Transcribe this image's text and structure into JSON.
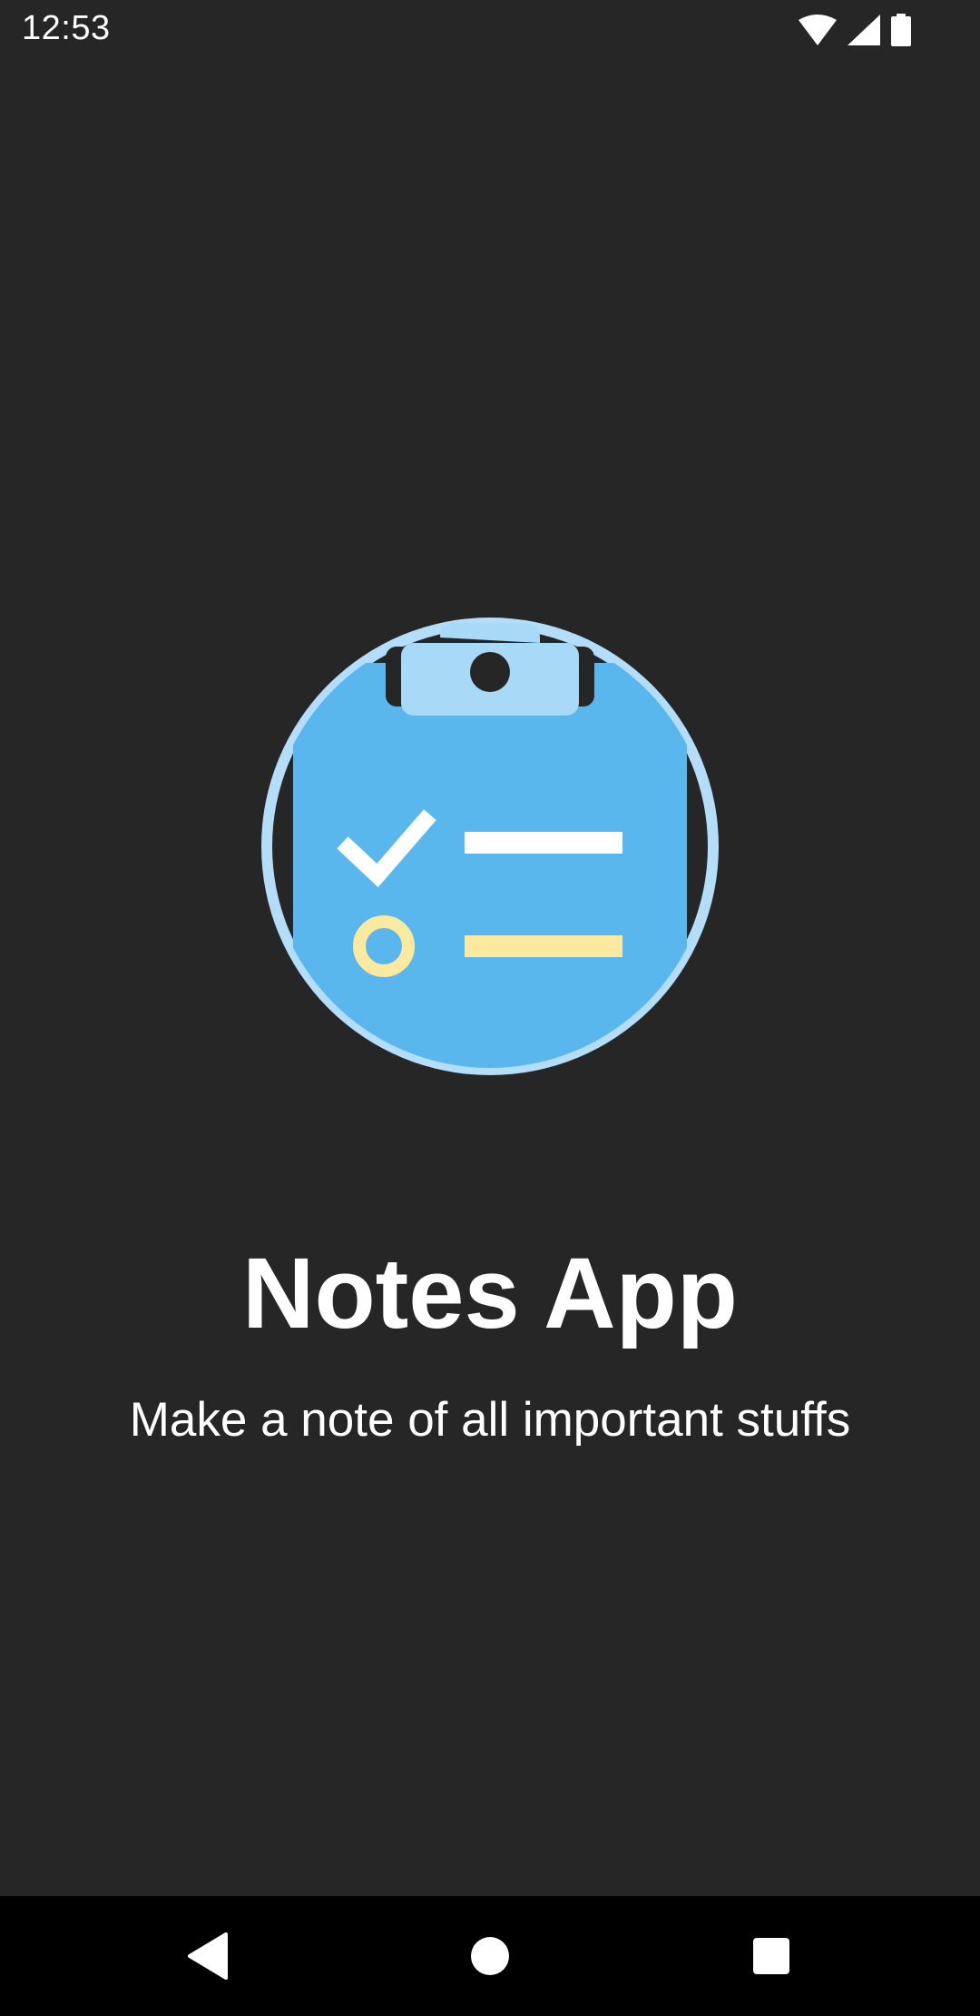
{
  "status_bar": {
    "time": "12:53",
    "icons": [
      "wifi-icon",
      "cell-signal-icon",
      "battery-icon"
    ]
  },
  "splash": {
    "logo_icon": "clipboard-checklist-icon",
    "title": "Notes App",
    "subtitle": "Make a note of all important stuffs"
  },
  "nav_bar": {
    "buttons": [
      "back-icon",
      "home-icon",
      "recents-icon"
    ]
  },
  "colors": {
    "background": "#262626",
    "logo_ring": "#B3DDF8",
    "clipboard": "#5AB7EE",
    "clip": "#A8DAF8",
    "todo_pending": "#FCE9A0",
    "text": "#FFFFFF"
  }
}
